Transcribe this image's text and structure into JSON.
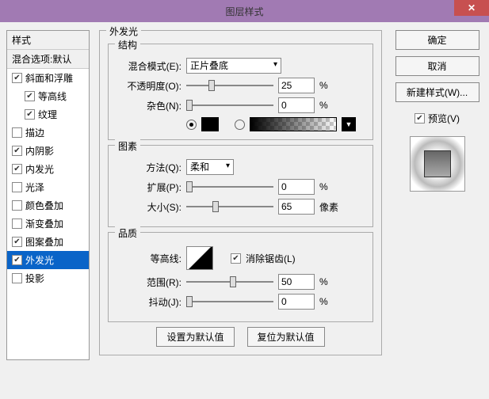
{
  "window": {
    "title": "图层样式",
    "close": "✕"
  },
  "stylesList": {
    "header": "样式",
    "blend": "混合选项:默认",
    "items": [
      {
        "label": "斜面和浮雕",
        "checked": true,
        "indent": false
      },
      {
        "label": "等高线",
        "checked": true,
        "indent": true
      },
      {
        "label": "纹理",
        "checked": true,
        "indent": true
      },
      {
        "label": "描边",
        "checked": false,
        "indent": false
      },
      {
        "label": "内阴影",
        "checked": true,
        "indent": false
      },
      {
        "label": "内发光",
        "checked": true,
        "indent": false
      },
      {
        "label": "光泽",
        "checked": false,
        "indent": false
      },
      {
        "label": "颜色叠加",
        "checked": false,
        "indent": false
      },
      {
        "label": "渐变叠加",
        "checked": false,
        "indent": false
      },
      {
        "label": "图案叠加",
        "checked": true,
        "indent": false
      },
      {
        "label": "外发光",
        "checked": true,
        "indent": false,
        "selected": true
      },
      {
        "label": "投影",
        "checked": false,
        "indent": false
      }
    ]
  },
  "panel": {
    "title": "外发光",
    "structure": {
      "title": "结构",
      "blendModeLabel": "混合模式(E):",
      "blendModeValue": "正片叠底",
      "opacityLabel": "不透明度(O):",
      "opacityValue": "25",
      "opacityUnit": "%",
      "noiseLabel": "杂色(N):",
      "noiseValue": "0",
      "noiseUnit": "%"
    },
    "elements": {
      "title": "图素",
      "techniqueLabel": "方法(Q):",
      "techniqueValue": "柔和",
      "spreadLabel": "扩展(P):",
      "spreadValue": "0",
      "spreadUnit": "%",
      "sizeLabel": "大小(S):",
      "sizeValue": "65",
      "sizeUnit": "像素"
    },
    "quality": {
      "title": "品质",
      "contourLabel": "等高线:",
      "antialiasLabel": "消除锯齿(L)",
      "rangeLabel": "范围(R):",
      "rangeValue": "50",
      "rangeUnit": "%",
      "jitterLabel": "抖动(J):",
      "jitterValue": "0",
      "jitterUnit": "%"
    },
    "buttons": {
      "setDefault": "设置为默认值",
      "resetDefault": "复位为默认值"
    }
  },
  "right": {
    "ok": "确定",
    "cancel": "取消",
    "newStyle": "新建样式(W)...",
    "previewLabel": "预览(V)"
  }
}
